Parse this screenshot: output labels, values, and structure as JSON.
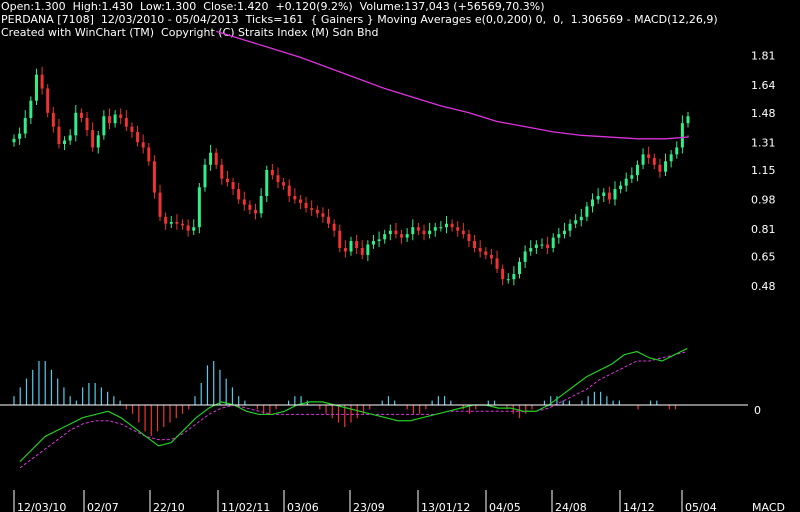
{
  "header": {
    "line1": "Open:1.300  High:1.430  Low:1.300  Close:1.420  +0.120(9.2%)  Volume:137,043 (+56569,70.3%)",
    "line2": "PERDANA [7108]  12/03/2010 - 05/04/2013  Ticks=161  { Gainers } Moving Averages e(0,0,200) 0,  0,  1.306569 - MACD(12,26,9)",
    "line3": "Created with WinChart (TM)  Copyright (C) Straits Index (M) Sdn Bhd"
  },
  "colors": {
    "background": "#000000",
    "up": "#33ee88",
    "down": "#ee3333",
    "ma": "#dd33dd",
    "macd_line": "#22cc22",
    "signal_line": "#dd33dd",
    "hist_pos": "#55ccee",
    "hist_neg": "#ee3333",
    "axis": "#ffffff"
  },
  "chart_data": [
    {
      "type": "candlestick",
      "title": "PERDANA [7108]",
      "y_ticks": [
        "1.81",
        "1.64",
        "1.48",
        "1.31",
        "1.15",
        "0.98",
        "0.81",
        "0.65",
        "0.48"
      ],
      "ylim": [
        0.4,
        1.9
      ],
      "x_ticks": [
        "12/03/10",
        "02/07",
        "22/10",
        "11/02/11",
        "03/06",
        "23/09",
        "13/01/12",
        "04/05",
        "24/08",
        "14/12",
        "05/04"
      ],
      "close": [
        1.33,
        1.36,
        1.45,
        1.55,
        1.7,
        1.62,
        1.48,
        1.4,
        1.3,
        1.32,
        1.35,
        1.48,
        1.45,
        1.38,
        1.28,
        1.35,
        1.46,
        1.42,
        1.47,
        1.45,
        1.4,
        1.37,
        1.31,
        1.28,
        1.2,
        1.02,
        0.88,
        0.84,
        0.85,
        0.84,
        0.83,
        0.8,
        0.82,
        1.05,
        1.18,
        1.25,
        1.18,
        1.1,
        1.08,
        1.04,
        0.98,
        0.95,
        0.92,
        0.9,
        1.0,
        1.15,
        1.12,
        1.08,
        1.06,
        1.0,
        0.98,
        0.96,
        0.93,
        0.92,
        0.9,
        0.88,
        0.84,
        0.8,
        0.7,
        0.68,
        0.74,
        0.7,
        0.66,
        0.72,
        0.74,
        0.75,
        0.78,
        0.8,
        0.78,
        0.76,
        0.78,
        0.82,
        0.8,
        0.78,
        0.8,
        0.82,
        0.82,
        0.84,
        0.82,
        0.8,
        0.78,
        0.74,
        0.7,
        0.68,
        0.66,
        0.64,
        0.58,
        0.52,
        0.52,
        0.55,
        0.62,
        0.68,
        0.7,
        0.72,
        0.72,
        0.7,
        0.76,
        0.78,
        0.8,
        0.84,
        0.86,
        0.88,
        0.94,
        0.98,
        1.0,
        1.02,
        0.98,
        1.04,
        1.06,
        1.1,
        1.12,
        1.18,
        1.24,
        1.22,
        1.18,
        1.14,
        1.2,
        1.24,
        1.28,
        1.42,
        1.46
      ],
      "moving_average": [
        1.95,
        1.9,
        1.85,
        1.8,
        1.74,
        1.68,
        1.62,
        1.57,
        1.52,
        1.48,
        1.43,
        1.4,
        1.37,
        1.35,
        1.34,
        1.33,
        1.33,
        1.34,
        1.35
      ],
      "moving_average_start_index": 36,
      "moving_average_step": 5
    },
    {
      "type": "macd",
      "title": "MACD(12,26,9)",
      "zero_label": "0",
      "label": "MACD",
      "histogram": [
        0.02,
        0.04,
        0.06,
        0.08,
        0.1,
        0.1,
        0.08,
        0.06,
        0.04,
        0.02,
        0.01,
        0.04,
        0.05,
        0.05,
        0.04,
        0.03,
        0.02,
        0.01,
        -0.01,
        -0.02,
        -0.04,
        -0.06,
        -0.07,
        -0.06,
        -0.05,
        -0.04,
        -0.03,
        -0.02,
        -0.01,
        0.02,
        0.05,
        0.09,
        0.1,
        0.08,
        0.06,
        0.04,
        0.02,
        0.01,
        0,
        -0.01,
        -0.02,
        -0.02,
        -0.01,
        0,
        0.01,
        0.02,
        0.02,
        0.01,
        0,
        -0.01,
        -0.02,
        -0.03,
        -0.04,
        -0.05,
        -0.04,
        -0.03,
        -0.02,
        -0.01,
        0,
        0.01,
        0.02,
        0.01,
        0,
        -0.01,
        -0.02,
        -0.02,
        -0.01,
        0.01,
        0.02,
        0.02,
        0.01,
        0,
        -0.01,
        -0.02,
        -0.01,
        0,
        0.01,
        0.01,
        0,
        -0.01,
        -0.02,
        -0.03,
        -0.02,
        -0.01,
        0,
        0.01,
        0.02,
        0.02,
        0.01,
        0.01,
        0,
        0.01,
        0.02,
        0.03,
        0.03,
        0.02,
        0.01,
        0.01,
        0,
        0,
        -0.01,
        0,
        0.01,
        0.01,
        0,
        -0.01,
        -0.01,
        0,
        0
      ],
      "macd": [
        -0.18,
        -0.14,
        -0.1,
        -0.08,
        -0.06,
        -0.04,
        -0.03,
        -0.02,
        -0.04,
        -0.07,
        -0.1,
        -0.13,
        -0.12,
        -0.08,
        -0.04,
        -0.01,
        0.01,
        0.0,
        -0.02,
        -0.03,
        -0.03,
        -0.02,
        0.0,
        0.01,
        0.01,
        0.0,
        -0.01,
        -0.02,
        -0.03,
        -0.04,
        -0.05,
        -0.05,
        -0.04,
        -0.03,
        -0.02,
        -0.01,
        0.0,
        0.0,
        -0.01,
        -0.01,
        -0.02,
        -0.02,
        0.0,
        0.03,
        0.06,
        0.09,
        0.11,
        0.13,
        0.16,
        0.17,
        0.15,
        0.14,
        0.16,
        0.18
      ],
      "signal": [
        -0.2,
        -0.17,
        -0.14,
        -0.11,
        -0.08,
        -0.06,
        -0.05,
        -0.05,
        -0.06,
        -0.08,
        -0.1,
        -0.11,
        -0.11,
        -0.09,
        -0.06,
        -0.03,
        -0.01,
        0.0,
        -0.01,
        -0.02,
        -0.03,
        -0.03,
        -0.03,
        -0.03,
        -0.03,
        -0.03,
        -0.03,
        -0.03,
        -0.03,
        -0.03,
        -0.03,
        -0.03,
        -0.03,
        -0.03,
        -0.02,
        -0.02,
        -0.02,
        -0.02,
        -0.02,
        -0.02,
        -0.02,
        -0.02,
        -0.01,
        0.01,
        0.03,
        0.05,
        0.08,
        0.1,
        0.12,
        0.14,
        0.14,
        0.15,
        0.16,
        0.17
      ],
      "ylim": [
        -0.22,
        0.13
      ]
    }
  ]
}
